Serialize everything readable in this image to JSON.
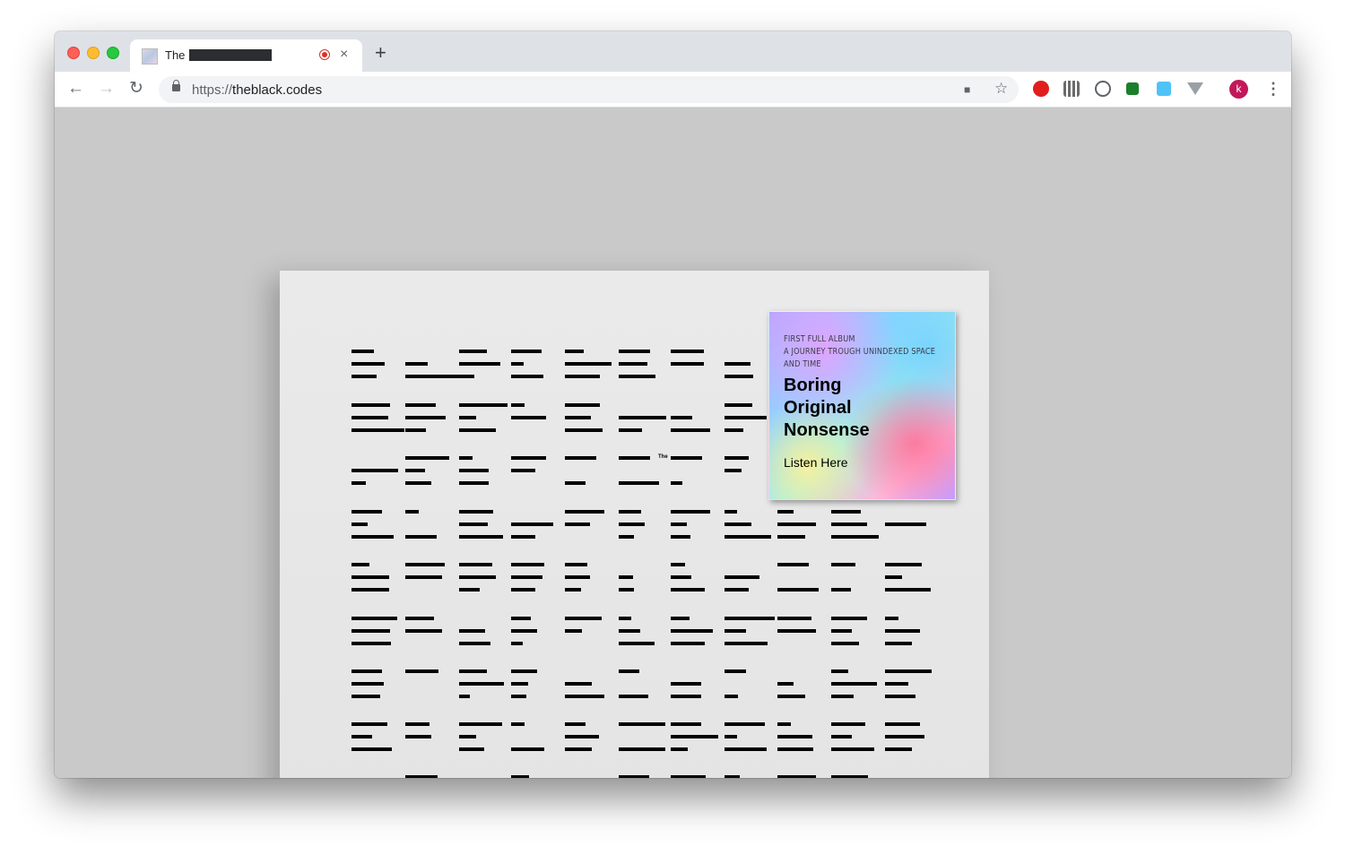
{
  "browser": {
    "tab": {
      "title": "The",
      "close_glyph": "×",
      "favicon_icon": "page-favicon-icon",
      "recording_icon": "recording-dot-icon"
    },
    "new_tab_glyph": "+",
    "nav": {
      "back": "←",
      "forward": "→",
      "reload": "↻"
    },
    "url_scheme": "https://",
    "url_host": "theblack.codes",
    "omnibox_icons": {
      "camera": "■",
      "star": "☆"
    },
    "extensions": [
      {
        "name": "adblock-icon",
        "color": "#e11d1d"
      },
      {
        "name": "grid-extension-icon",
        "color": "#6b6b6b"
      },
      {
        "name": "circle-extension-icon",
        "color": "#5f6368"
      },
      {
        "name": "v-extension-icon",
        "color": "#1a7f2b"
      },
      {
        "name": "square-extension-icon",
        "color": "#4fc3f7"
      },
      {
        "name": "vue-extension-icon",
        "color": "#9aa0a6"
      }
    ],
    "avatar_letter": "k",
    "menu_glyph": "⋮"
  },
  "page": {
    "tiny_text": "The",
    "album": {
      "line1": "FIRST FULL ALBUM",
      "line2": "A JOURNEY TROUGH UNINDEXED SPACE",
      "line3": "AND TIME",
      "title1": "Boring",
      "title2": "Original",
      "title3": "Nonsense",
      "link": "Listen Here"
    }
  }
}
